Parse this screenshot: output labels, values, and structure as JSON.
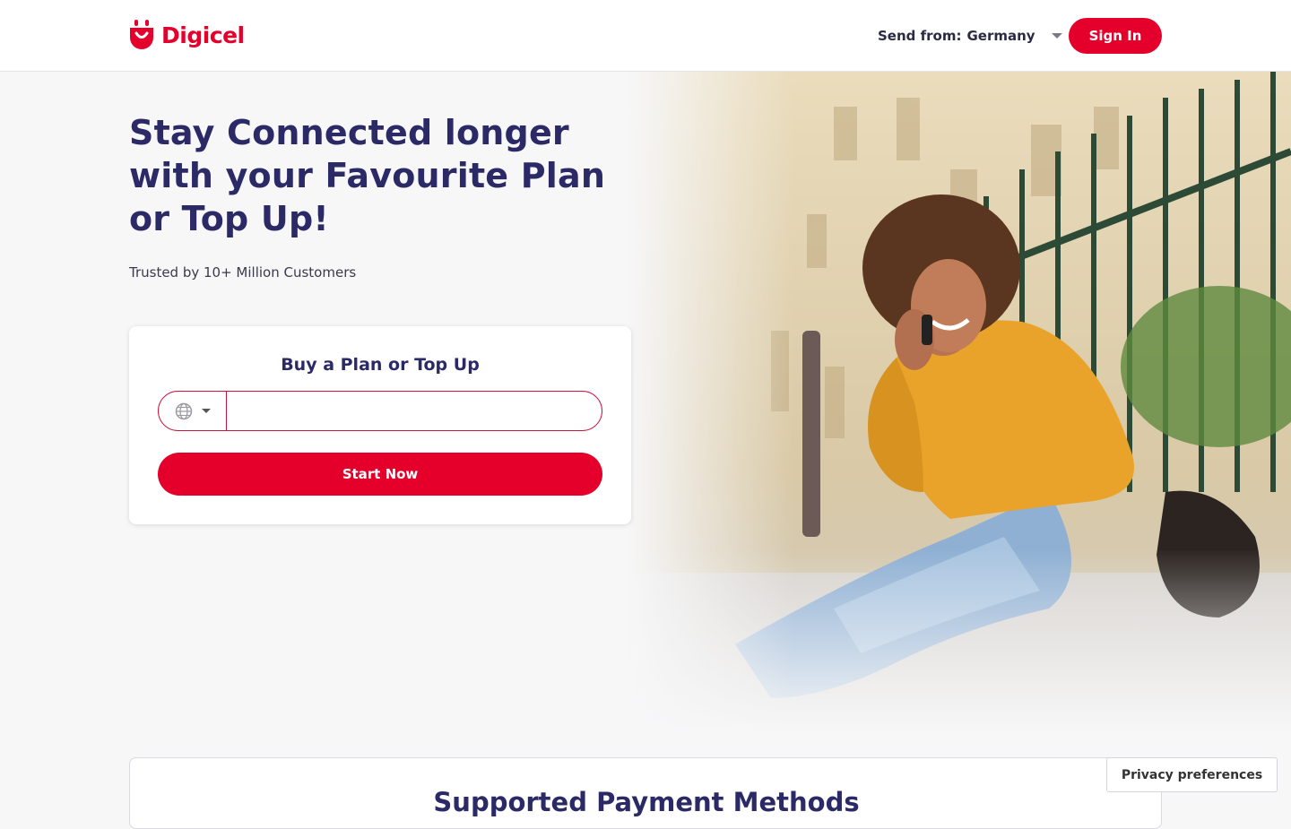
{
  "brand": {
    "name": "Digicel",
    "accent_color": "#e4002b",
    "text_color": "#2b2a66",
    "logo_icon": "digicel-smile-logo"
  },
  "header": {
    "send_from_label": "Send from:",
    "send_from_value": "Germany",
    "sign_in_label": "Sign In"
  },
  "hero": {
    "headline": "Stay Connected longer with your Favourite Plan or Top Up!",
    "subline": "Trusted by 10+ Million Customers",
    "image_icon": "woman-on-phone-photo"
  },
  "topup_card": {
    "title": "Buy a Plan or Top Up",
    "country_icon": "globe-icon",
    "phone_value": "",
    "start_label": "Start Now"
  },
  "payment": {
    "title": "Supported Payment Methods"
  },
  "privacy": {
    "label": "Privacy preferences"
  }
}
